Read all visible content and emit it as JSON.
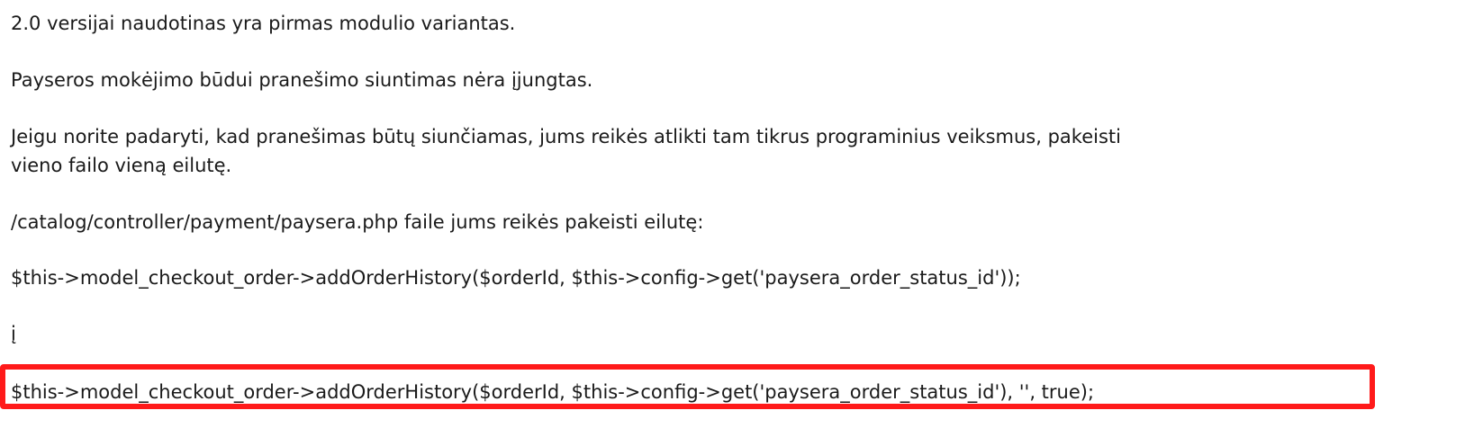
{
  "paragraphs": {
    "p1": "2.0 versijai naudotinas yra pirmas modulio variantas.",
    "p2": "Payseros mokėjimo būdui pranešimo siuntimas nėra įjungtas.",
    "p3_line1": "Jeigu norite padaryti, kad pranešimas būtų siunčiamas, jums reikės atlikti tam tikrus programinius veiksmus, pakeisti",
    "p3_line2": "vieno failo vieną eilutę.",
    "p4": "/catalog/controller/payment/paysera.php faile jums reikės pakeisti eilutę:"
  },
  "code": {
    "original_line": "$this->model_checkout_order->addOrderHistory($orderId, $this->config->get('paysera_order_status_id'));",
    "connector": "į",
    "replacement_line": "$this->model_checkout_order->addOrderHistory($orderId, $this->config->get('paysera_order_status_id'), '', true);"
  },
  "colors": {
    "highlight_border": "#ff1a1a",
    "text": "#1a1a1a",
    "background": "#ffffff"
  }
}
